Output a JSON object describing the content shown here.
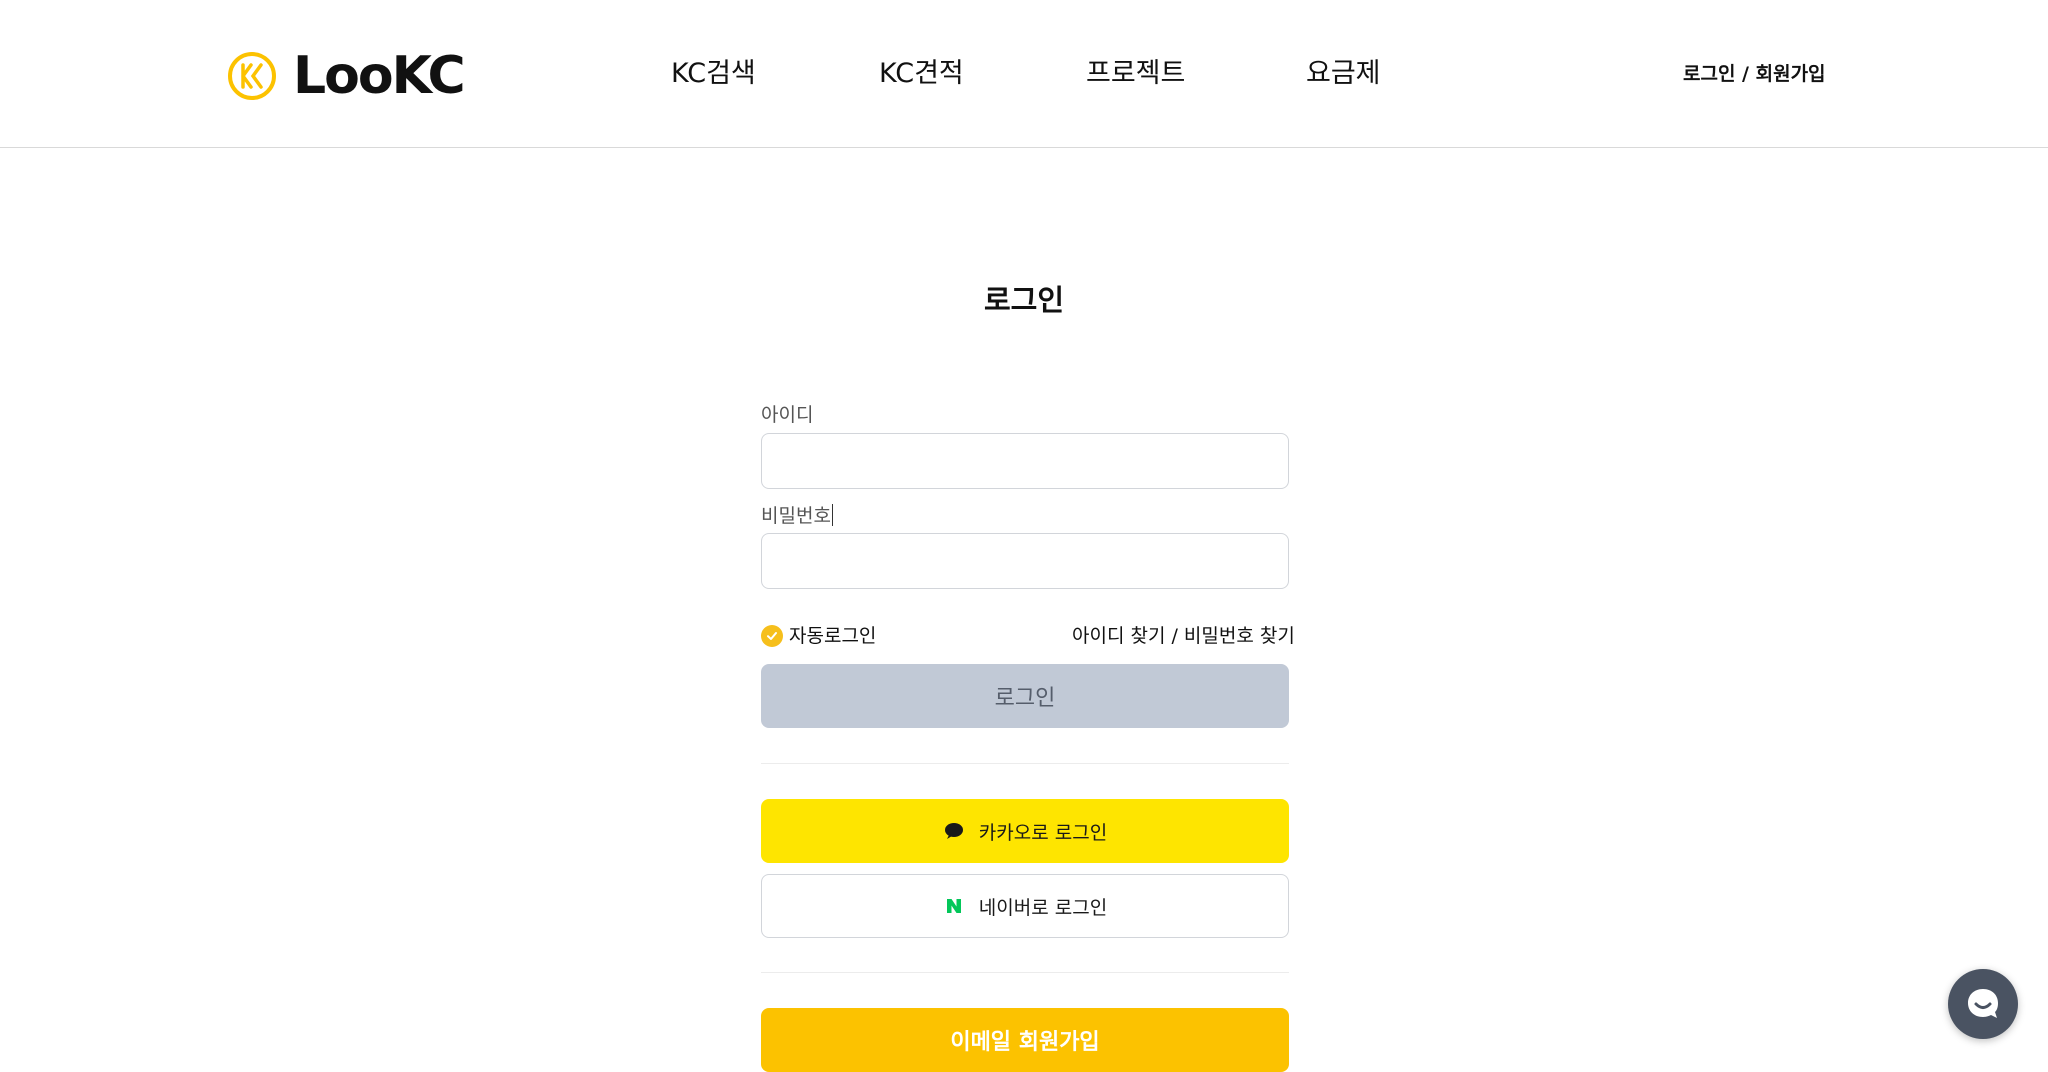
{
  "header": {
    "logo_text": "LooKC",
    "nav": [
      "KC검색",
      "KC견적",
      "프로젝트",
      "요금제"
    ],
    "auth_link": "로그인 / 회원가입"
  },
  "login": {
    "title": "로그인",
    "id_label": "아이디",
    "id_value": "",
    "password_label": "비밀번호",
    "password_value": "",
    "remember_label": "자동로그인",
    "remember_checked": true,
    "find_link": "아이디 찾기 / 비밀번호 찾기",
    "submit_label": "로그인",
    "kakao_label": "카카오로 로그인",
    "naver_label": "네이버로 로그인",
    "email_signup_label": "이메일 회원가입"
  },
  "colors": {
    "brand_yellow": "#fcc200",
    "kakao": "#fee500",
    "naver_green": "#03c75a",
    "disabled_button": "#c1c9d6",
    "chat_fab": "#4a5362"
  },
  "icons": {
    "logo": "lookc-logo-icon",
    "remember": "check-circle-icon",
    "kakao": "kakao-speech-bubble-icon",
    "naver": "naver-n-icon",
    "chat": "chat-bubble-icon"
  }
}
